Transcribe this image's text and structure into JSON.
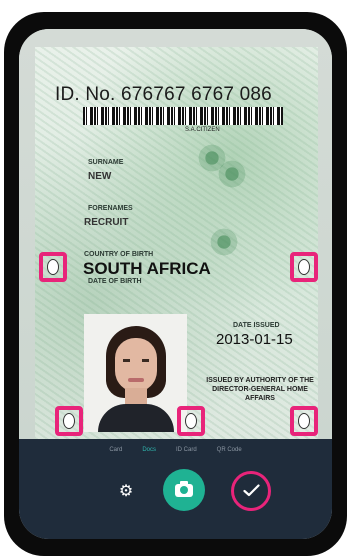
{
  "id_card": {
    "id_number": "ID. No. 676767 6767 086",
    "barcode_caption": "S.A.CITIZEN",
    "surname_label": "SURNAME",
    "surname": "NEW",
    "forenames_label": "FORENAMES",
    "forenames": "RECRUIT",
    "country_label": "COUNTRY OF BIRTH",
    "country": "SOUTH AFRICA",
    "dob_label": "DATE OF BIRTH",
    "date_issued_label": "DATE ISSUED",
    "date_issued": "2013-01-15",
    "authority": "ISSUED BY AUTHORITY OF THE DIRECTOR-GENERAL HOME AFFAIRS"
  },
  "mode_bar": {
    "modes": [
      "Card",
      "Docs",
      "ID Card",
      "QR Code"
    ],
    "active_index": 1
  },
  "controls": {
    "settings_icon": "gear-icon",
    "capture_icon": "camera-icon",
    "confirm_icon": "checkmark-icon"
  },
  "colors": {
    "accent_pink": "#e8247a",
    "capture_green": "#1fb293",
    "toolbar_bg": "#1f2c3b",
    "active_mode": "#2fb8b0"
  }
}
